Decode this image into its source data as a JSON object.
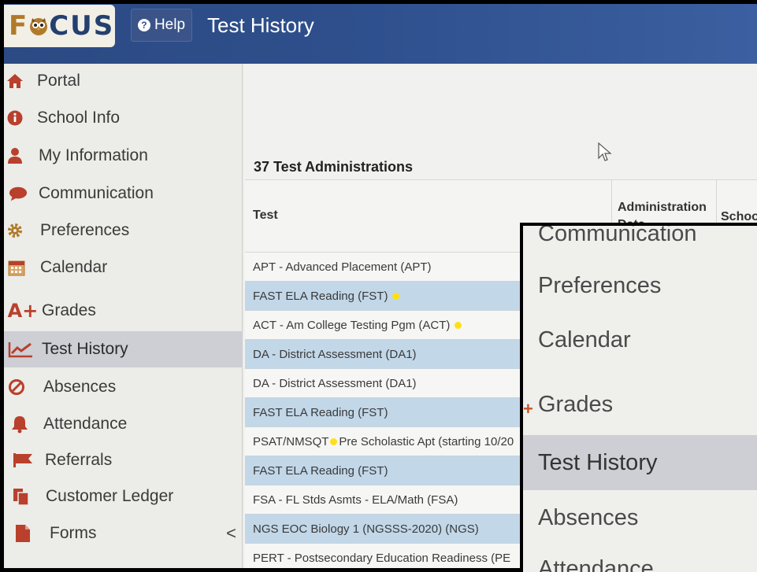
{
  "header": {
    "logo_text": "FOCUS",
    "help_label": "Help",
    "page_title": "Test History"
  },
  "sidebar": {
    "items": [
      {
        "label": "Portal",
        "icon": "home-icon"
      },
      {
        "label": "School Info",
        "icon": "info-icon"
      },
      {
        "label": "My Information",
        "icon": "person-icon"
      },
      {
        "label": "Communication",
        "icon": "chat-bubble-icon"
      },
      {
        "label": "Preferences",
        "icon": "gear-icon"
      },
      {
        "label": "Calendar",
        "icon": "calendar-icon"
      },
      {
        "label": "Grades",
        "icon": "grade-a-plus-icon"
      },
      {
        "label": "Test History",
        "icon": "trend-chart-icon",
        "active": true
      },
      {
        "label": "Absences",
        "icon": "prohibited-icon"
      },
      {
        "label": "Attendance",
        "icon": "bell-icon"
      },
      {
        "label": "Referrals",
        "icon": "flag-icon"
      },
      {
        "label": "Customer Ledger",
        "icon": "ledger-icon"
      },
      {
        "label": "Forms",
        "icon": "document-icon",
        "chevron": "<"
      }
    ]
  },
  "main": {
    "count_title": "37 Test Administrations",
    "columns": [
      "Test",
      "Administration Date",
      "Schoo"
    ],
    "rows": [
      {
        "text": "APT - Advanced Placement (APT)",
        "dot": false
      },
      {
        "text": "FAST ELA Reading (FST)",
        "dot": true
      },
      {
        "text": "ACT - Am College Testing Pgm (ACT)",
        "dot": true
      },
      {
        "text": "DA - District Assessment (DA1)",
        "dot": false
      },
      {
        "text": "DA - District Assessment (DA1)",
        "dot": false
      },
      {
        "text": "FAST ELA Reading (FST)",
        "dot": false
      },
      {
        "text_before": "PSAT/NMSQT",
        "text_after": "Pre Scholastic Apt (starting 10/20",
        "dot": true
      },
      {
        "text": "FAST ELA Reading (FST)",
        "dot": false
      },
      {
        "text": "FSA - FL Stds Asmts - ELA/Math (FSA)",
        "dot": false
      },
      {
        "text": "NGS EOC Biology 1 (NGSSS-2020) (NGS)",
        "dot": false
      },
      {
        "text": "PERT - Postsecondary Education Readiness (PE",
        "dot": false
      }
    ]
  },
  "inset": {
    "items": [
      "Communication",
      "Preferences",
      "Calendar",
      "Grades",
      "Test History",
      "Absences",
      "Attendance"
    ]
  },
  "colors": {
    "header_blue": "#2e4f8c",
    "row_blue": "#c2d7e8",
    "active_nav": "#cdcfd5",
    "status_dot": "#ffe017",
    "icon_red": "#b8402c"
  }
}
